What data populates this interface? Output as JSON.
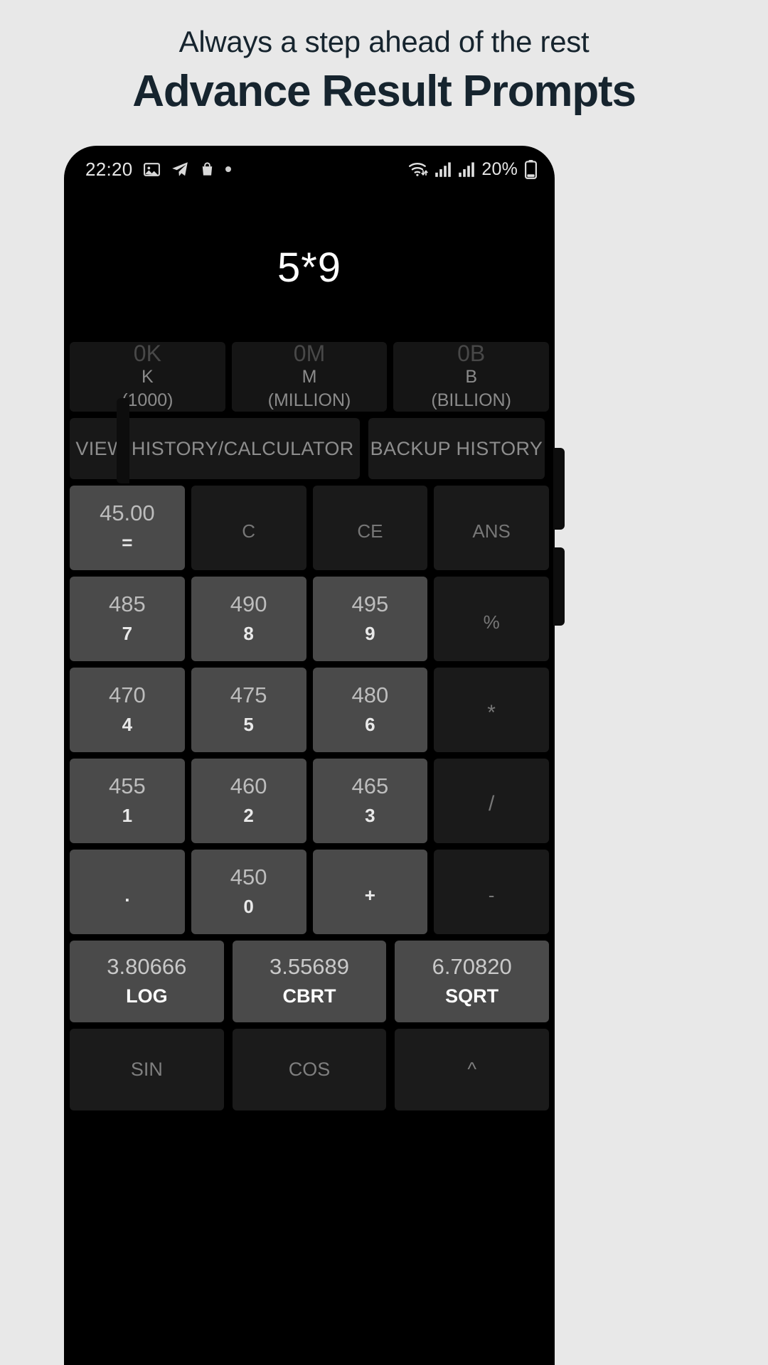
{
  "promo": {
    "subtitle": "Always a step ahead of the rest",
    "title": "Advance Result Prompts"
  },
  "statusbar": {
    "time": "22:20",
    "icons": [
      "image-icon",
      "telegram-icon",
      "shopping-bag-icon",
      "dot-indicator"
    ],
    "wifi": "wifi-icon",
    "signal1": "signal-bars-icon",
    "signal2": "signal-bars-icon",
    "battery_pct": "20%",
    "battery": "battery-icon"
  },
  "calculator": {
    "display": "5*9",
    "units": [
      {
        "hint": "0K",
        "label": "K",
        "sub": "(1000)"
      },
      {
        "hint": "0M",
        "label": "M",
        "sub": "(MILLION)"
      },
      {
        "hint": "0B",
        "label": "B",
        "sub": "(BILLION)"
      }
    ],
    "history": {
      "view": "VIEW HISTORY/CALCULATOR",
      "backup": "BACKUP HISTORY"
    },
    "keys": [
      [
        {
          "hint": "45.00",
          "label": "=",
          "style": "lit"
        },
        {
          "hint": "",
          "label": "C",
          "style": "dim"
        },
        {
          "hint": "",
          "label": "CE",
          "style": "dim"
        },
        {
          "hint": "",
          "label": "ANS",
          "style": "dim"
        }
      ],
      [
        {
          "hint": "485",
          "label": "7",
          "style": "lit"
        },
        {
          "hint": "490",
          "label": "8",
          "style": "lit"
        },
        {
          "hint": "495",
          "label": "9",
          "style": "lit"
        },
        {
          "hint": "",
          "label": "%",
          "style": "dim"
        }
      ],
      [
        {
          "hint": "470",
          "label": "4",
          "style": "lit"
        },
        {
          "hint": "475",
          "label": "5",
          "style": "lit"
        },
        {
          "hint": "480",
          "label": "6",
          "style": "lit"
        },
        {
          "hint": "",
          "label": "*",
          "style": "dim"
        }
      ],
      [
        {
          "hint": "455",
          "label": "1",
          "style": "lit"
        },
        {
          "hint": "460",
          "label": "2",
          "style": "lit"
        },
        {
          "hint": "465",
          "label": "3",
          "style": "lit"
        },
        {
          "hint": "",
          "label": "/",
          "style": "dim"
        }
      ],
      [
        {
          "hint": "",
          "label": ".",
          "style": "lit"
        },
        {
          "hint": "450",
          "label": "0",
          "style": "lit"
        },
        {
          "hint": "",
          "label": "+",
          "style": "lit"
        },
        {
          "hint": "",
          "label": "-",
          "style": "dim"
        }
      ]
    ],
    "functions": [
      {
        "hint": "3.80666",
        "label": "LOG"
      },
      {
        "hint": "3.55689",
        "label": "CBRT"
      },
      {
        "hint": "6.70820",
        "label": "SQRT"
      }
    ],
    "trig": [
      {
        "label": "SIN"
      },
      {
        "label": "COS"
      },
      {
        "label": "^"
      }
    ]
  },
  "colors": {
    "page_bg": "#e8e8e8",
    "header_text": "#16242e",
    "device_bg": "#000000",
    "key_active": "#4a4a4a",
    "key_inactive": "#1a1a1a",
    "hint_text": "#8d8d8d"
  }
}
